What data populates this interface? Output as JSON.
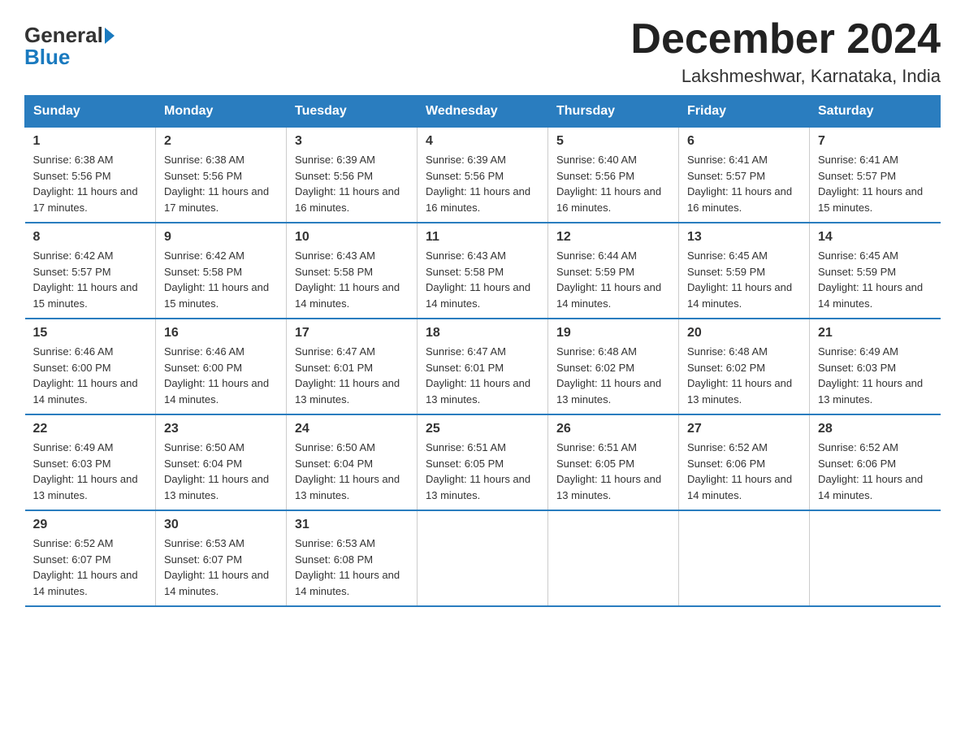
{
  "header": {
    "logo_general": "General",
    "logo_blue": "Blue",
    "month_year": "December 2024",
    "location": "Lakshmeshwar, Karnataka, India"
  },
  "days_of_week": [
    "Sunday",
    "Monday",
    "Tuesday",
    "Wednesday",
    "Thursday",
    "Friday",
    "Saturday"
  ],
  "weeks": [
    [
      {
        "day": "1",
        "sunrise": "6:38 AM",
        "sunset": "5:56 PM",
        "daylight": "11 hours and 17 minutes."
      },
      {
        "day": "2",
        "sunrise": "6:38 AM",
        "sunset": "5:56 PM",
        "daylight": "11 hours and 17 minutes."
      },
      {
        "day": "3",
        "sunrise": "6:39 AM",
        "sunset": "5:56 PM",
        "daylight": "11 hours and 16 minutes."
      },
      {
        "day": "4",
        "sunrise": "6:39 AM",
        "sunset": "5:56 PM",
        "daylight": "11 hours and 16 minutes."
      },
      {
        "day": "5",
        "sunrise": "6:40 AM",
        "sunset": "5:56 PM",
        "daylight": "11 hours and 16 minutes."
      },
      {
        "day": "6",
        "sunrise": "6:41 AM",
        "sunset": "5:57 PM",
        "daylight": "11 hours and 16 minutes."
      },
      {
        "day": "7",
        "sunrise": "6:41 AM",
        "sunset": "5:57 PM",
        "daylight": "11 hours and 15 minutes."
      }
    ],
    [
      {
        "day": "8",
        "sunrise": "6:42 AM",
        "sunset": "5:57 PM",
        "daylight": "11 hours and 15 minutes."
      },
      {
        "day": "9",
        "sunrise": "6:42 AM",
        "sunset": "5:58 PM",
        "daylight": "11 hours and 15 minutes."
      },
      {
        "day": "10",
        "sunrise": "6:43 AM",
        "sunset": "5:58 PM",
        "daylight": "11 hours and 14 minutes."
      },
      {
        "day": "11",
        "sunrise": "6:43 AM",
        "sunset": "5:58 PM",
        "daylight": "11 hours and 14 minutes."
      },
      {
        "day": "12",
        "sunrise": "6:44 AM",
        "sunset": "5:59 PM",
        "daylight": "11 hours and 14 minutes."
      },
      {
        "day": "13",
        "sunrise": "6:45 AM",
        "sunset": "5:59 PM",
        "daylight": "11 hours and 14 minutes."
      },
      {
        "day": "14",
        "sunrise": "6:45 AM",
        "sunset": "5:59 PM",
        "daylight": "11 hours and 14 minutes."
      }
    ],
    [
      {
        "day": "15",
        "sunrise": "6:46 AM",
        "sunset": "6:00 PM",
        "daylight": "11 hours and 14 minutes."
      },
      {
        "day": "16",
        "sunrise": "6:46 AM",
        "sunset": "6:00 PM",
        "daylight": "11 hours and 14 minutes."
      },
      {
        "day": "17",
        "sunrise": "6:47 AM",
        "sunset": "6:01 PM",
        "daylight": "11 hours and 13 minutes."
      },
      {
        "day": "18",
        "sunrise": "6:47 AM",
        "sunset": "6:01 PM",
        "daylight": "11 hours and 13 minutes."
      },
      {
        "day": "19",
        "sunrise": "6:48 AM",
        "sunset": "6:02 PM",
        "daylight": "11 hours and 13 minutes."
      },
      {
        "day": "20",
        "sunrise": "6:48 AM",
        "sunset": "6:02 PM",
        "daylight": "11 hours and 13 minutes."
      },
      {
        "day": "21",
        "sunrise": "6:49 AM",
        "sunset": "6:03 PM",
        "daylight": "11 hours and 13 minutes."
      }
    ],
    [
      {
        "day": "22",
        "sunrise": "6:49 AM",
        "sunset": "6:03 PM",
        "daylight": "11 hours and 13 minutes."
      },
      {
        "day": "23",
        "sunrise": "6:50 AM",
        "sunset": "6:04 PM",
        "daylight": "11 hours and 13 minutes."
      },
      {
        "day": "24",
        "sunrise": "6:50 AM",
        "sunset": "6:04 PM",
        "daylight": "11 hours and 13 minutes."
      },
      {
        "day": "25",
        "sunrise": "6:51 AM",
        "sunset": "6:05 PM",
        "daylight": "11 hours and 13 minutes."
      },
      {
        "day": "26",
        "sunrise": "6:51 AM",
        "sunset": "6:05 PM",
        "daylight": "11 hours and 13 minutes."
      },
      {
        "day": "27",
        "sunrise": "6:52 AM",
        "sunset": "6:06 PM",
        "daylight": "11 hours and 14 minutes."
      },
      {
        "day": "28",
        "sunrise": "6:52 AM",
        "sunset": "6:06 PM",
        "daylight": "11 hours and 14 minutes."
      }
    ],
    [
      {
        "day": "29",
        "sunrise": "6:52 AM",
        "sunset": "6:07 PM",
        "daylight": "11 hours and 14 minutes."
      },
      {
        "day": "30",
        "sunrise": "6:53 AM",
        "sunset": "6:07 PM",
        "daylight": "11 hours and 14 minutes."
      },
      {
        "day": "31",
        "sunrise": "6:53 AM",
        "sunset": "6:08 PM",
        "daylight": "11 hours and 14 minutes."
      },
      {
        "day": "",
        "sunrise": "",
        "sunset": "",
        "daylight": ""
      },
      {
        "day": "",
        "sunrise": "",
        "sunset": "",
        "daylight": ""
      },
      {
        "day": "",
        "sunrise": "",
        "sunset": "",
        "daylight": ""
      },
      {
        "day": "",
        "sunrise": "",
        "sunset": "",
        "daylight": ""
      }
    ]
  ]
}
